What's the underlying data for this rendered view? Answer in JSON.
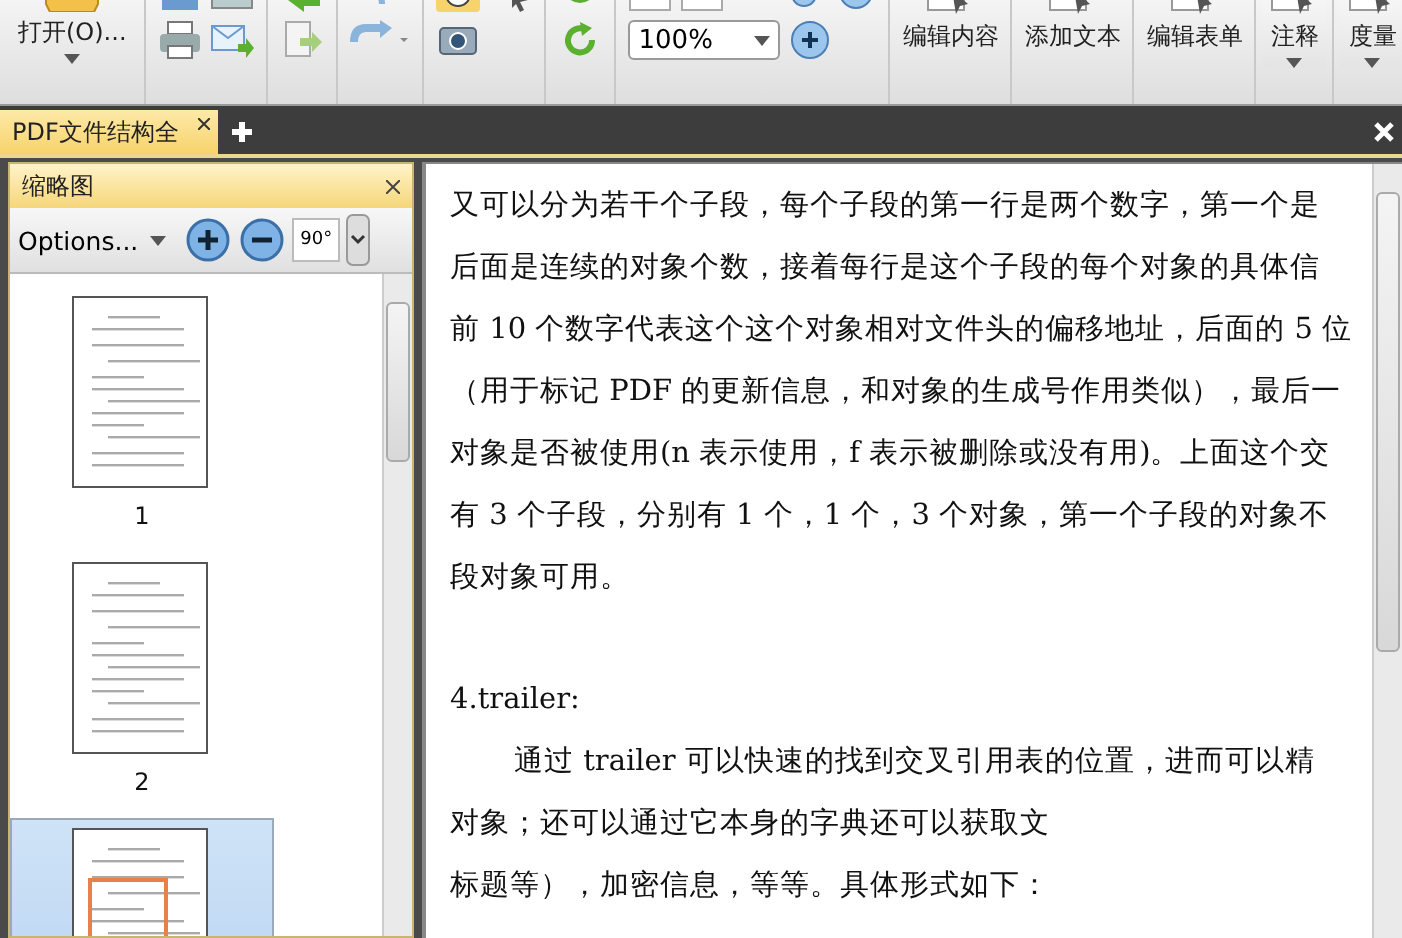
{
  "toolbar": {
    "open_button": {
      "label": "打开(O)..."
    },
    "zoom_field": {
      "value": "100%"
    },
    "tools": [
      {
        "label": "编辑内容",
        "dropdown": false
      },
      {
        "label": "添加文本",
        "dropdown": false
      },
      {
        "label": "编辑表单",
        "dropdown": false
      },
      {
        "label": "注释",
        "dropdown": true
      },
      {
        "label": "度量",
        "dropdown": true
      }
    ]
  },
  "tabs": [
    {
      "label": "PDF文件结构全",
      "selected": true
    }
  ],
  "thumbnail_panel": {
    "title": "缩略图",
    "options": "Options...",
    "rotate_label": "90°",
    "pages": [
      {
        "label": "1",
        "selected": false
      },
      {
        "label": "2",
        "selected": false
      },
      {
        "selected": true
      }
    ]
  },
  "document": {
    "sections": [
      {
        "lines": [
          {
            "text": "又可以分为若干个子段，每个子段的第一行是两个数字，第一个是",
            "indent": false
          },
          {
            "text": "后面是连续的对象个数，接着每行是这个子段的每个对象的具体信",
            "indent": false
          },
          {
            "text": "前 10 个数字代表这个这个对象相对文件头的偏移地址，后面的 5 位",
            "indent": false
          },
          {
            "text": "（用于标记 PDF 的更新信息，和对象的生成号作用类似），最后一",
            "indent": false
          },
          {
            "text": "对象是否被使用(n 表示使用，f 表示被删除或没有用)。上面这个交",
            "indent": false
          },
          {
            "text": "有 3 个子段，分别有 1 个，1 个，3 个对象，第一个子段的对象不",
            "indent": false
          },
          {
            "text": "段对象可用。",
            "indent": false
          }
        ]
      },
      {
        "lines": [
          {
            "text": "4.trailer:",
            "indent": false
          },
          {
            "text": "通过 trailer 可以快速的找到交叉引用表的位置，进而可以精",
            "indent": true
          },
          {
            "text": "对象；还可以通过它本身的字典还可以获取文",
            "indent": false
          },
          {
            "text": "标题等），加密信息，等等。具体形式如下：",
            "indent": false
          }
        ]
      }
    ]
  }
}
